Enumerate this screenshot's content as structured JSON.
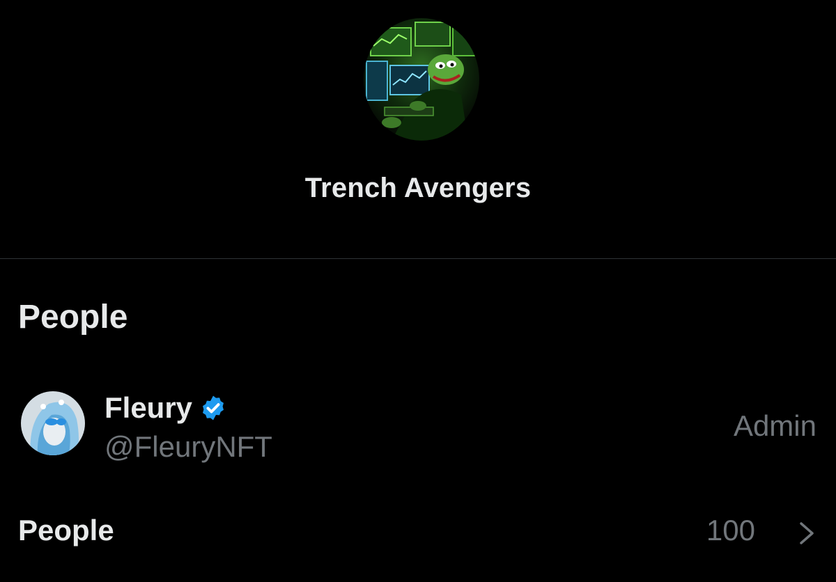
{
  "group": {
    "name": "Trench Avengers"
  },
  "section": {
    "heading": "People"
  },
  "member": {
    "name": "Fleury",
    "handle": "@FleuryNFT",
    "role": "Admin",
    "verified": true,
    "verified_color": "#1d9bf0"
  },
  "people_row": {
    "label": "People",
    "count": "100",
    "icon": "chevron-right-icon"
  },
  "colors": {
    "background": "#000000",
    "primary_text": "#e7e9ea",
    "secondary_text": "#71767b",
    "divider": "#2f3336"
  }
}
